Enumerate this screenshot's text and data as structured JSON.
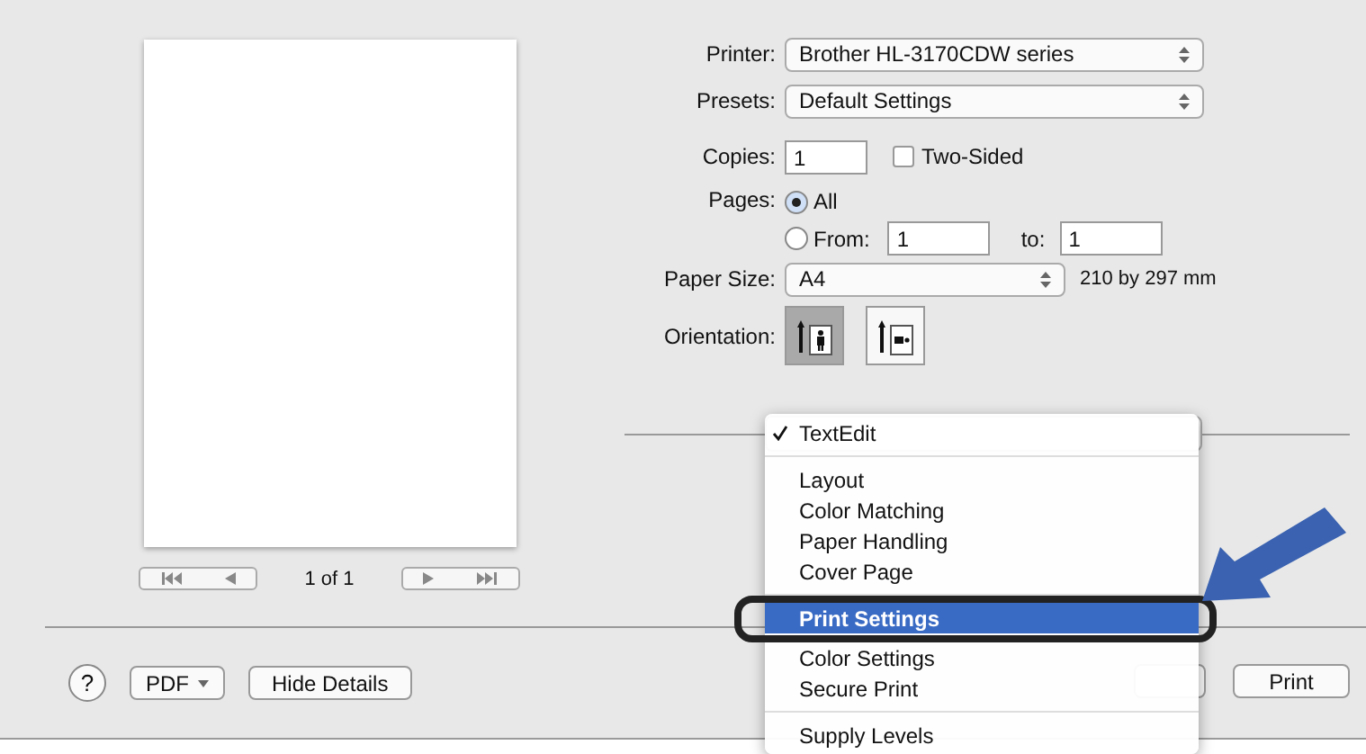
{
  "preview": {
    "page_count": "1 of 1"
  },
  "form": {
    "printer_label": "Printer:",
    "printer": "Brother HL-3170CDW series",
    "presets_label": "Presets:",
    "presets": "Default Settings",
    "copies_label": "Copies:",
    "copies": "1",
    "two_sided": {
      "label": "Two-Sided",
      "checked": false
    },
    "pages_label": "Pages:",
    "pages_options": [
      {
        "label": "All",
        "selected": true
      },
      {
        "label": "From:",
        "selected": false
      }
    ],
    "from": "1",
    "to_label": "to:",
    "to": "1",
    "paper_size_label": "Paper Size:",
    "paper_size": "A4",
    "paper_dims": "210 by 297 mm",
    "orientation_label": "Orientation:",
    "orientations": [
      {
        "kind": "portrait",
        "selected": true
      },
      {
        "kind": "landscape",
        "selected": false
      }
    ]
  },
  "menu": {
    "items": [
      {
        "kind": "item",
        "label": "TextEdit",
        "checked": true,
        "selected": false
      },
      {
        "kind": "separator"
      },
      {
        "kind": "item",
        "label": "Layout",
        "checked": false,
        "selected": false
      },
      {
        "kind": "item",
        "label": "Color Matching",
        "checked": false,
        "selected": false
      },
      {
        "kind": "item",
        "label": "Paper Handling",
        "checked": false,
        "selected": false
      },
      {
        "kind": "item",
        "label": "Cover Page",
        "checked": false,
        "selected": false
      },
      {
        "kind": "separator"
      },
      {
        "kind": "item",
        "label": "Print Settings",
        "checked": false,
        "selected": true
      },
      {
        "kind": "item",
        "label": "Color Settings",
        "checked": false,
        "selected": false
      },
      {
        "kind": "item",
        "label": "Secure Print",
        "checked": false,
        "selected": false
      },
      {
        "kind": "separator"
      },
      {
        "kind": "item",
        "label": "Supply Levels",
        "checked": false,
        "selected": false
      }
    ]
  },
  "bottom": {
    "help": "?",
    "pdf": "PDF",
    "hide_details": "Hide Details",
    "print": "Print"
  }
}
